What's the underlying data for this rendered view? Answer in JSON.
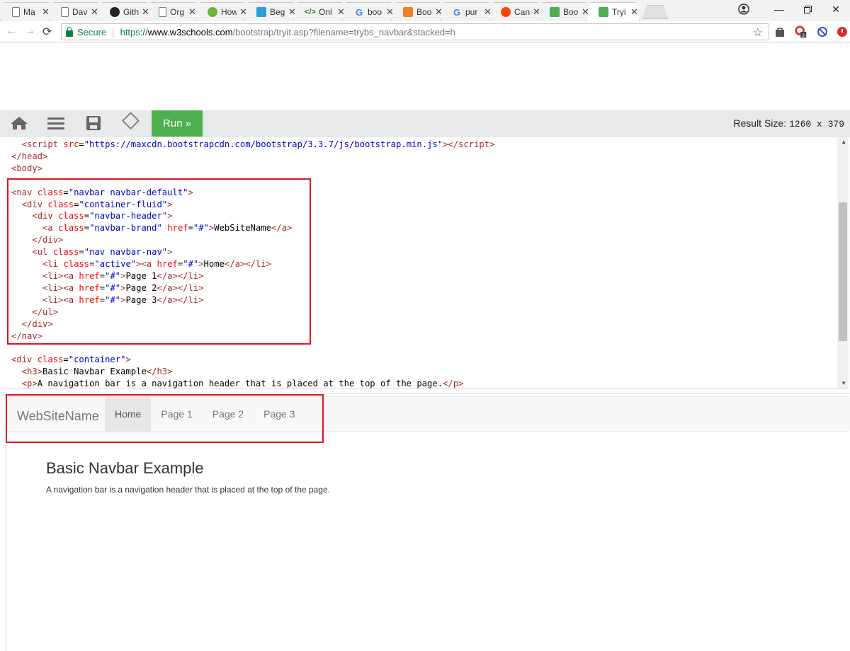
{
  "browser": {
    "tabs": [
      {
        "title": "Ma",
        "icon": "document-icon",
        "color": "#777777"
      },
      {
        "title": "Dav",
        "icon": "document-icon",
        "color": "#777777"
      },
      {
        "title": "Gith",
        "icon": "github-icon",
        "color": "#222222"
      },
      {
        "title": "Org",
        "icon": "document-icon",
        "color": "#777777"
      },
      {
        "title": "How",
        "icon": "leaf-icon",
        "color": "#6cb33e"
      },
      {
        "title": "Beg",
        "icon": "diamond-icon",
        "color": "#2a9fd8"
      },
      {
        "title": "Onl",
        "icon": "code-icon",
        "color": "#2e7d32"
      },
      {
        "title": "boo",
        "icon": "google-icon",
        "color": "#4285f4"
      },
      {
        "title": "Boo",
        "icon": "stack-icon",
        "color": "#f48024"
      },
      {
        "title": "pur",
        "icon": "google-icon",
        "color": "#4285f4"
      },
      {
        "title": "Can",
        "icon": "reddit-icon",
        "color": "#ff4500"
      },
      {
        "title": "Boo",
        "icon": "w3-icon",
        "color": "#4caf50"
      },
      {
        "title": "Tryi",
        "icon": "w3-icon",
        "color": "#4caf50",
        "active": true
      }
    ],
    "secure_label": "Secure",
    "url_scheme": "https://",
    "url_host": "www.w3schools.com",
    "url_path": "/bootstrap/tryit.asp?filename=trybs_navbar&stacked=h"
  },
  "toolbar": {
    "run_label": "Run »",
    "result_size_label": "Result Size:",
    "result_size_value": "1260 x 379"
  },
  "result": {
    "brand": "WebSiteName",
    "nav_items": [
      "Home",
      "Page 1",
      "Page 2",
      "Page 3"
    ],
    "heading": "Basic Navbar Example",
    "paragraph": "A navigation bar is a navigation header that is placed at the top of the page."
  },
  "colors": {
    "run_button": "#4caf50",
    "highlight_box": "#e0141e",
    "secure_green": "#0b8043"
  }
}
